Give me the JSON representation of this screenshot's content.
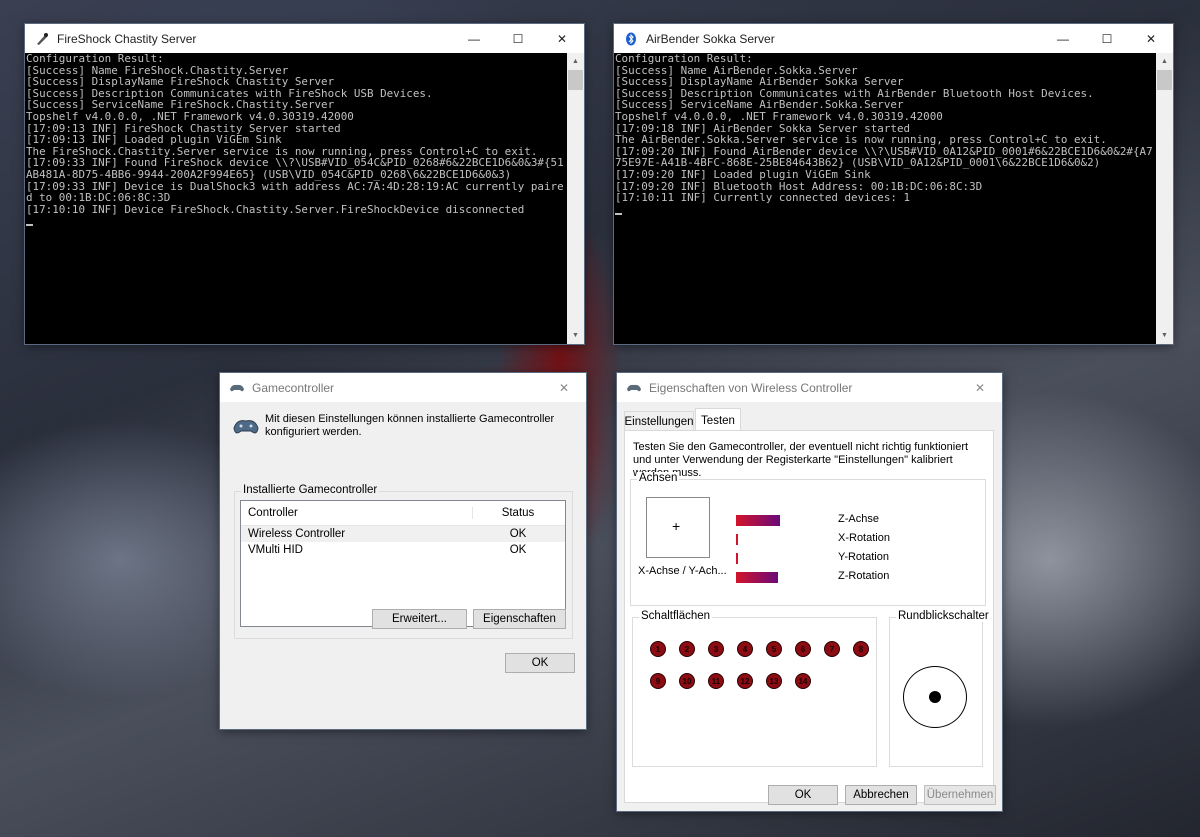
{
  "console1": {
    "title": "FireShock Chastity Server",
    "lines": "Configuration Result:\n[Success] Name FireShock.Chastity.Server\n[Success] DisplayName FireShock Chastity Server\n[Success] Description Communicates with FireShock USB Devices.\n[Success] ServiceName FireShock.Chastity.Server\nTopshelf v4.0.0.0, .NET Framework v4.0.30319.42000\n[17:09:13 INF] FireShock Chastity Server started\n[17:09:13 INF] Loaded plugin ViGEm Sink\nThe FireShock.Chastity.Server service is now running, press Control+C to exit.\n[17:09:33 INF] Found FireShock device \\\\?\\USB#VID_054C&PID_0268#6&22BCE1D6&0&3#{51AB481A-8D75-4BB6-9944-200A2F994E65} (USB\\VID_054C&PID_0268\\6&22BCE1D6&0&3)\n[17:09:33 INF] Device is DualShock3 with address AC:7A:4D:28:19:AC currently paired to 00:1B:DC:06:8C:3D\n[17:10:10 INF] Device FireShock.Chastity.Server.FireShockDevice disconnected"
  },
  "console2": {
    "title": "AirBender Sokka Server",
    "lines": "Configuration Result:\n[Success] Name AirBender.Sokka.Server\n[Success] DisplayName AirBender Sokka Server\n[Success] Description Communicates with AirBender Bluetooth Host Devices.\n[Success] ServiceName AirBender.Sokka.Server\nTopshelf v4.0.0.0, .NET Framework v4.0.30319.42000\n[17:09:18 INF] AirBender Sokka Server started\nThe AirBender.Sokka.Server service is now running, press Control+C to exit.\n[17:09:20 INF] Found AirBender device \\\\?\\USB#VID_0A12&PID_0001#6&22BCE1D6&0&2#{A775E97E-A41B-4BFC-868E-25BE84643B62} (USB\\VID_0A12&PID_0001\\6&22BCE1D6&0&2)\n[17:09:20 INF] Loaded plugin ViGEm Sink\n[17:09:20 INF] Bluetooth Host Address: 00:1B:DC:06:8C:3D\n[17:10:11 INF] Currently connected devices: 1"
  },
  "gamecontroller": {
    "title": "Gamecontroller",
    "intro": "Mit diesen Einstellungen können installierte Gamecontroller konfiguriert werden.",
    "group_label": "Installierte Gamecontroller",
    "col_controller": "Controller",
    "col_status": "Status",
    "rows": [
      {
        "name": "Wireless Controller",
        "status": "OK"
      },
      {
        "name": "VMulti HID",
        "status": "OK"
      }
    ],
    "advanced_button": "Erweitert...",
    "properties_button": "Eigenschaften",
    "ok_button": "OK"
  },
  "props": {
    "title": "Eigenschaften von Wireless Controller",
    "tab_settings": "Einstellungen",
    "tab_test": "Testen",
    "description": "Testen Sie den Gamecontroller, der eventuell nicht richtig funktioniert und unter Verwendung der Registerkarte \"Einstellungen\" kalibriert werden muss.",
    "axes_label": "Achsen",
    "xy_label": "X-Achse / Y-Ach...",
    "axes": [
      {
        "label": "Z-Achse",
        "fill": 0.44
      },
      {
        "label": "X-Rotation",
        "fill": 0.02
      },
      {
        "label": "Y-Rotation",
        "fill": 0.02
      },
      {
        "label": "Z-Rotation",
        "fill": 0.42
      }
    ],
    "buttons_label": "Schaltflächen",
    "buttons_row1": [
      "1",
      "2",
      "3",
      "4",
      "5",
      "6",
      "7",
      "8"
    ],
    "buttons_row2": [
      "9",
      "10",
      "11",
      "12",
      "13",
      "14"
    ],
    "pov_label": "Rundblickschalter",
    "ok_button": "OK",
    "cancel_button": "Abbrechen",
    "apply_button": "Übernehmen"
  },
  "colors": {
    "axis_bar": "#d2142b",
    "button_pressed": "#8b0c13"
  }
}
